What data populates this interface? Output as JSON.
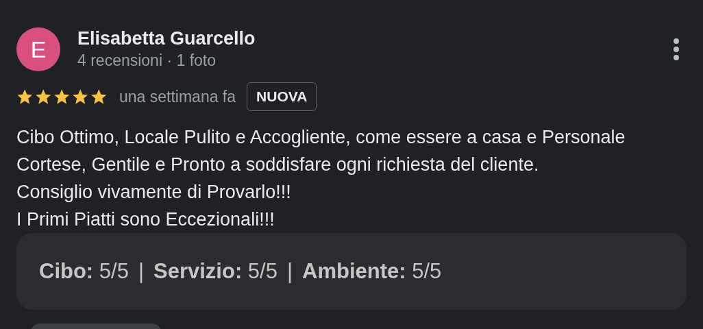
{
  "reviewer": {
    "initial": "E",
    "name": "Elisabetta Guarcello",
    "meta": "4 recensioni · 1 foto"
  },
  "rating": {
    "stars": 5,
    "time": "una settimana fa",
    "badge": "NUOVA"
  },
  "review_text": [
    "Cibo Ottimo, Locale Pulito e Accogliente, come essere a casa e Personale Cortese, Gentile e Pronto a soddisfare ogni richiesta del cliente.",
    "Consiglio vivamente di Provarlo!!!",
    "I Primi Piatti sono Eccezionali!!!"
  ],
  "sub_ratings": [
    {
      "label": "Cibo:",
      "value": "5/5"
    },
    {
      "label": "Servizio:",
      "value": "5/5"
    },
    {
      "label": "Ambiente:",
      "value": "5/5"
    }
  ],
  "separators": [
    "|",
    "|"
  ]
}
